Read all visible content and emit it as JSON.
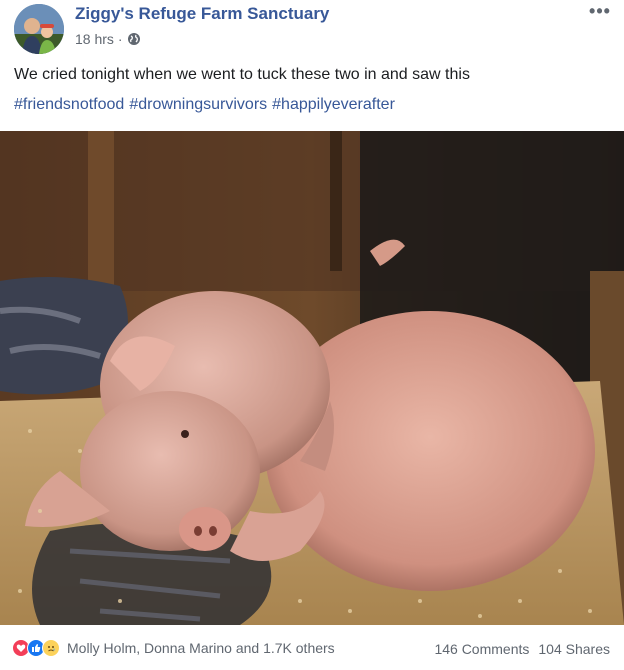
{
  "post": {
    "page_name": "Ziggy's Refuge Farm Sanctuary",
    "timestamp": "18 hrs",
    "separator": "·",
    "privacy_icon": "globe-icon",
    "more_icon": "more-options-icon",
    "more_label": "•••",
    "caption": "We cried tonight when we went to tuck these two in and saw this",
    "hashtags": [
      "#friendsnotfood",
      "#drowningsurvivors",
      "#happilyeverafter"
    ],
    "photo_icon": "photo-two-pigs-sleeping"
  },
  "footer": {
    "reaction_icons": [
      "love-reaction-icon",
      "like-reaction-icon",
      "sad-reaction-icon"
    ],
    "reaction_names": "Molly Holm, Donna Marino and 1.7K others",
    "comments": "146 Comments",
    "shares": "104 Shares"
  },
  "colors": {
    "link": "#385898",
    "secondary_text": "#606770",
    "love": "#f33e58",
    "like": "#1877f2",
    "sad": "#fcd25b"
  }
}
